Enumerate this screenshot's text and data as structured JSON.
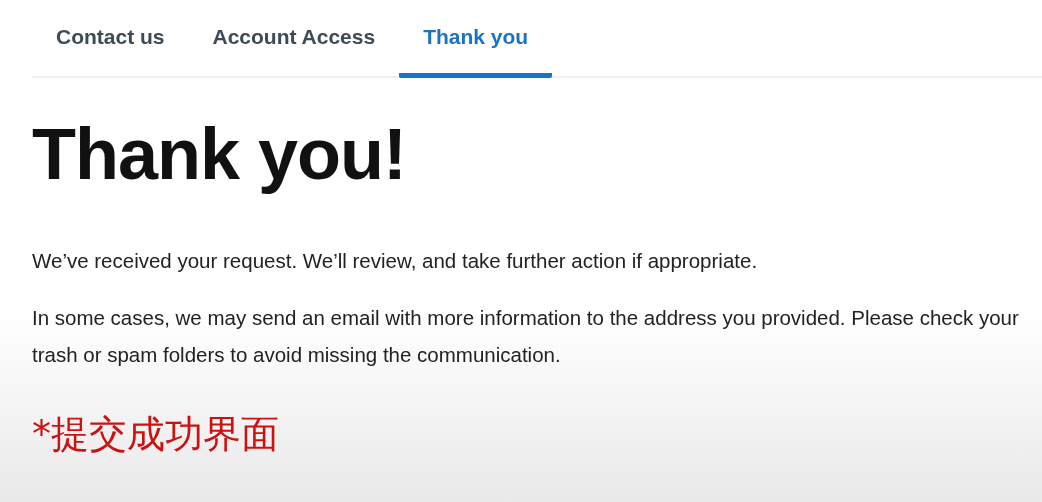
{
  "tabs": [
    {
      "label": "Contact us",
      "selected": false
    },
    {
      "label": "Account Access",
      "selected": false
    },
    {
      "label": "Thank you",
      "selected": true
    }
  ],
  "heading": "Thank you!",
  "paragraphs": [
    "We’ve received your request. We’ll review, and take further action if appropriate.",
    "In some cases, we may send an email with more information to the address you provided. Please check your trash or spam folders to avoid missing the communication."
  ],
  "caption": "*提交成功界面"
}
